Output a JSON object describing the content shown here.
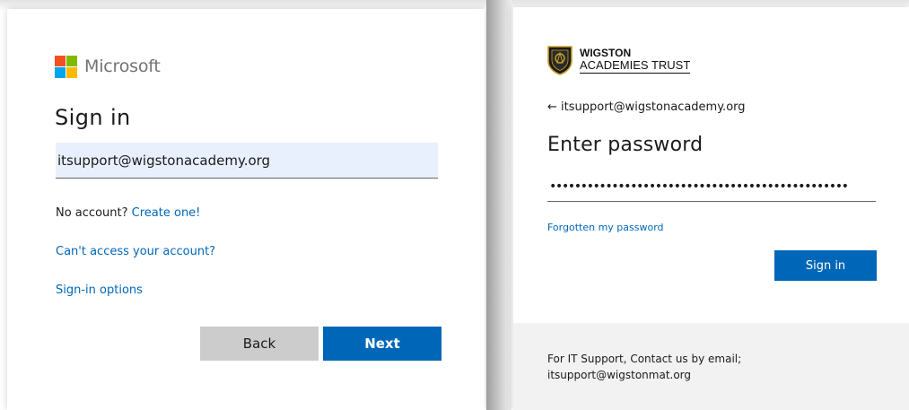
{
  "left_panel": {
    "brand": {
      "logo_icon": "microsoft-logo-icon",
      "name": "Microsoft",
      "colors": [
        "#f25022",
        "#7fba00",
        "#00a4ef",
        "#ffb900"
      ]
    },
    "title": "Sign in",
    "email_value": "itsupport@wigstonacademy.org",
    "no_account_text": "No account?",
    "create_link": "Create one!",
    "cant_access_link": "Can't access your account?",
    "signin_options_link": "Sign-in options",
    "back_button": "Back",
    "next_button": "Next"
  },
  "right_panel": {
    "org": {
      "logo_icon": "crest-shield-icon",
      "name_line1": "WIGSTON",
      "name_line2": "ACADEMIES TRUST"
    },
    "back_arrow": "←",
    "account": "itsupport@wigstonacademy.org",
    "title": "Enter password",
    "password_masked": "••••••••••••••••••••••••••••••••••••••••••••••••",
    "forgot_link": "Forgotten my password",
    "signin_button": "Sign in",
    "footer_line1": "For IT Support, Contact us by email;",
    "footer_line2": "itsupport@wigstonmat.org"
  },
  "theme": {
    "accent": "#0067b8",
    "input_fill": "#e8f0fe",
    "back_button_bg": "#cccccc",
    "footer_bg": "#f2f2f2"
  }
}
